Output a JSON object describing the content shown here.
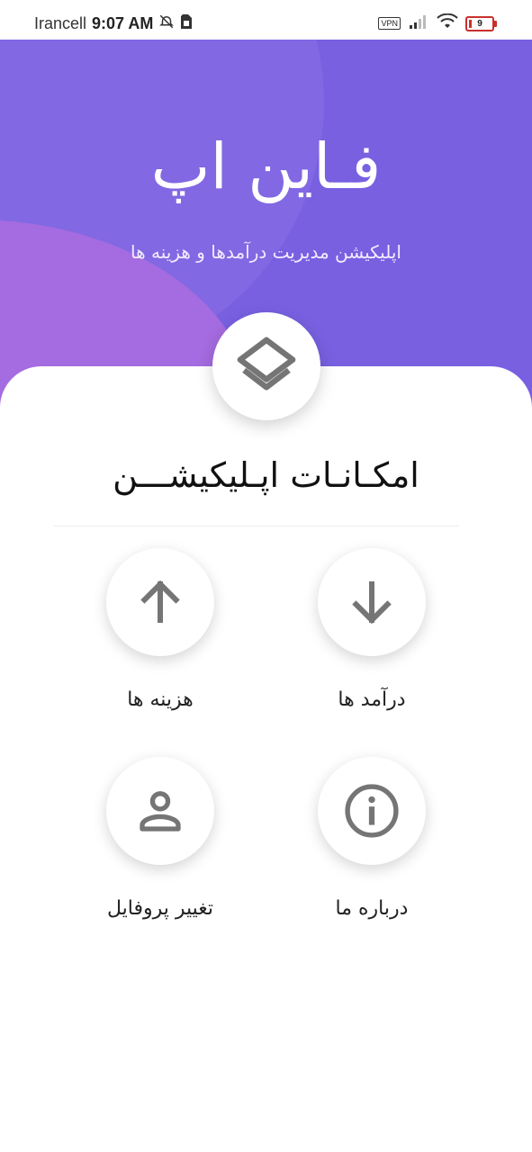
{
  "status_bar": {
    "carrier": "Irancell",
    "time": "9:07 AM",
    "vpn": "VPN",
    "battery": "9",
    "icons": [
      "alarm-off-icon",
      "sim-icon",
      "signal-icon",
      "wifi-icon",
      "battery-icon"
    ]
  },
  "header": {
    "title": "فـاین اپ",
    "subtitle": "اپلیکیشن مدیریت درآمدها و هزینه ها",
    "logo_icon": "layers-icon"
  },
  "colors": {
    "header_primary": "#7860e1",
    "header_accent": "#a56be0",
    "icon_gray": "#757575"
  },
  "features": {
    "title": "امکـانـات اپـلیکیشـــن",
    "items": [
      {
        "label": "هزینه ها",
        "icon": "arrow-up-icon"
      },
      {
        "label": "درآمد ها",
        "icon": "arrow-down-icon"
      },
      {
        "label": "تغییر پروفایل",
        "icon": "person-icon"
      },
      {
        "label": "درباره ما",
        "icon": "info-icon"
      }
    ]
  }
}
